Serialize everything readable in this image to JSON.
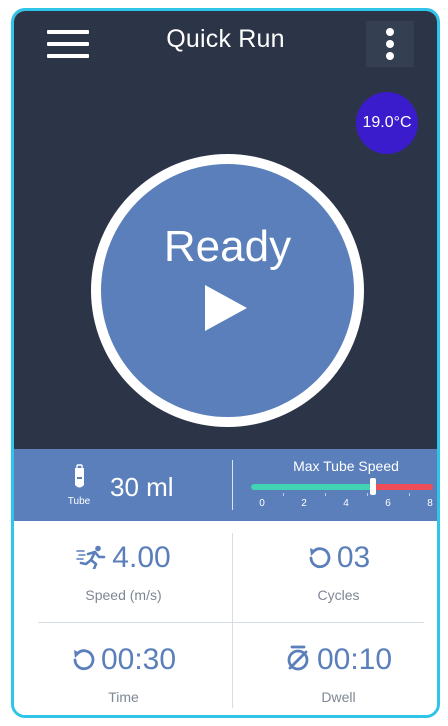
{
  "header": {
    "title": "Quick Run"
  },
  "temperature": "19.0°C",
  "main_button": {
    "label": "Ready"
  },
  "tube": {
    "caption": "Tube",
    "volume": "30 ml"
  },
  "max_tube_speed": {
    "title": "Max Tube Speed",
    "ticks": [
      "0",
      "2",
      "4",
      "6",
      "8"
    ],
    "value": 5.3,
    "range": [
      0,
      8
    ]
  },
  "stats": {
    "speed": {
      "value": "4.00",
      "label": "Speed (m/s)"
    },
    "cycles": {
      "value": "03",
      "label": "Cycles"
    },
    "time": {
      "value": "00:30",
      "label": "Time"
    },
    "dwell": {
      "value": "00:10",
      "label": "Dwell"
    }
  },
  "colors": {
    "background_dark": "#2b3547",
    "accent_blue": "#5a7fbb",
    "temp_badge": "#3a1ccc",
    "frame_border": "#2ec5e8",
    "slider_green": "#41d3b2",
    "slider_red": "#ef4d57"
  },
  "icons": {
    "menu": "hamburger-menu-icon",
    "more": "vertical-dots-icon",
    "play": "play-icon",
    "tube": "test-tube-icon",
    "speed": "running-person-icon",
    "cycles": "repeat-arrow-icon",
    "time": "rewind-clock-icon",
    "dwell": "stopwatch-icon"
  }
}
